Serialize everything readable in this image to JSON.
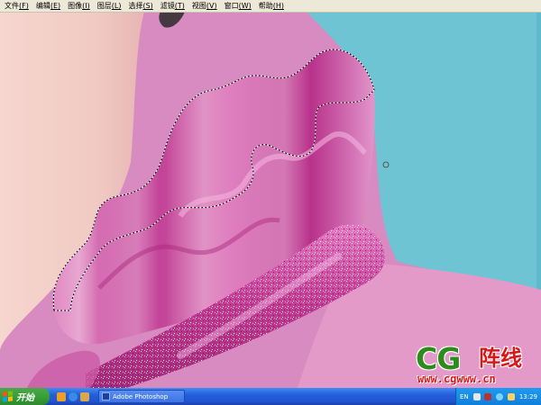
{
  "menu": {
    "items": [
      {
        "label": "文件",
        "mnemonic": "(F)"
      },
      {
        "label": "编辑",
        "mnemonic": "(E)"
      },
      {
        "label": "图像",
        "mnemonic": "(I)"
      },
      {
        "label": "图层",
        "mnemonic": "(L)"
      },
      {
        "label": "选择",
        "mnemonic": "(S)"
      },
      {
        "label": "滤镜",
        "mnemonic": "(T)"
      },
      {
        "label": "视图",
        "mnemonic": "(V)"
      },
      {
        "label": "窗口",
        "mnemonic": "(W)"
      },
      {
        "label": "帮助",
        "mnemonic": "(H)"
      }
    ]
  },
  "watermark": {
    "brand": "CG",
    "brand_cn": "阵线",
    "url": "www.cgwww.cn"
  },
  "taskbar": {
    "start_label": "开始",
    "task_label": "Adobe Photoshop",
    "lang": "EN",
    "clock": "13:29"
  },
  "colors": {
    "background_pink": "#d78bc0",
    "background_cyan": "#6fc4d4",
    "ruffle_magenta": "#c03a8e",
    "collar_magenta": "#b52e85",
    "taskbar_blue": "#245edb",
    "start_green": "#38a038"
  }
}
